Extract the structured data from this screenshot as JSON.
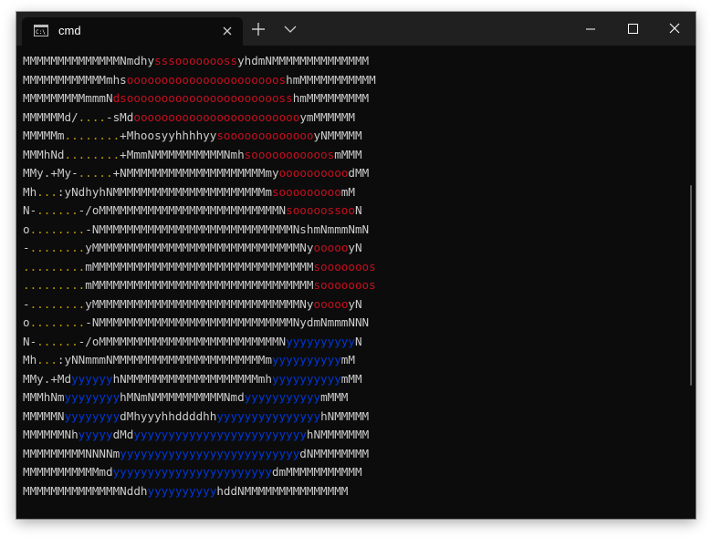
{
  "tab": {
    "title": "cmd",
    "icon": "cmd-icon"
  },
  "colors": {
    "white": "#cccccc",
    "red": "#c50f1f",
    "yellow": "#c19c00",
    "blue": "#0037da",
    "background": "#0c0c0c",
    "titlebar": "#202020"
  },
  "console_lines": [
    [
      [
        "w",
        "MMMMMMMMMMMMMMNmdhy"
      ],
      [
        "r",
        "sssoooooooss"
      ],
      [
        "w",
        "yhdmNMMMMMMMMMMMMMM"
      ]
    ],
    [
      [
        "w",
        "MMMMMMMMMMMMmhs"
      ],
      [
        "r",
        "oooooooooooooooooooooos"
      ],
      [
        "w",
        "hmMMMMMMMMMMM"
      ]
    ],
    [
      [
        "w",
        "MMMMMMMMMmmmN"
      ],
      [
        "r",
        "dsooooooooooooooooooooooss"
      ],
      [
        "w",
        "hmMMMMMMMMM"
      ]
    ],
    [
      [
        "w",
        "MMMMMMd/"
      ],
      [
        "y",
        "...."
      ],
      [
        "w",
        "-sMd"
      ],
      [
        "r",
        "oooooooooooooooooooooooo"
      ],
      [
        "w",
        "ymMMMMMM"
      ]
    ],
    [
      [
        "w",
        "MMMMMm"
      ],
      [
        "y",
        "........"
      ],
      [
        "w",
        "+Mhoosyyhhhhyy"
      ],
      [
        "r",
        "sooooooooooooo"
      ],
      [
        "w",
        "yNMMMMM"
      ]
    ],
    [
      [
        "w",
        "MMMhNd"
      ],
      [
        "y",
        "........"
      ],
      [
        "w",
        "+MmmNMMMMMMMMMMNmh"
      ],
      [
        "r",
        "sooooooooooos"
      ],
      [
        "w",
        "mMMM"
      ]
    ],
    [
      [
        "w",
        "MMy.+My-"
      ],
      [
        "y",
        "....."
      ],
      [
        "w",
        "+NMMMMMMMMMMMMMMMMMMMMmy"
      ],
      [
        "r",
        "oooooooooo"
      ],
      [
        "w",
        "dMM"
      ]
    ],
    [
      [
        "w",
        "Mh"
      ],
      [
        "y",
        "..."
      ],
      [
        "w",
        ":yNdhyhNMMMMMMMMMMMMMMMMMMMMMMm"
      ],
      [
        "r",
        "sooooooooo"
      ],
      [
        "w",
        "mM"
      ]
    ],
    [
      [
        "w",
        "N-"
      ],
      [
        "y",
        "......"
      ],
      [
        "w",
        "-/oMMMMMMMMMMMMMMMMMMMMMMMMMMN"
      ],
      [
        "r",
        "sooooossoo"
      ],
      [
        "w",
        "N"
      ]
    ],
    [
      [
        "w",
        "o"
      ],
      [
        "y",
        "........"
      ],
      [
        "w",
        "-NMMMMMMMMMMMMMMMMMMMMMMMMMMMMNshmNmmmNmN"
      ]
    ],
    [
      [
        "w",
        "-"
      ],
      [
        "y",
        "........"
      ],
      [
        "w",
        "yMMMMMMMMMMMMMMMMMMMMMMMMMMMMMMNy"
      ],
      [
        "r",
        "ooooo"
      ],
      [
        "w",
        "yN"
      ]
    ],
    [
      [
        "y",
        "........."
      ],
      [
        "w",
        "mMMMMMMMMMMMMMMMMMMMMMMMMMMMMMMMM"
      ],
      [
        "r",
        "sooooooos"
      ]
    ],
    [
      [
        "y",
        "........."
      ],
      [
        "w",
        "mMMMMMMMMMMMMMMMMMMMMMMMMMMMMMMMM"
      ],
      [
        "r",
        "sooooooos"
      ]
    ],
    [
      [
        "w",
        "-"
      ],
      [
        "y",
        "........"
      ],
      [
        "w",
        "yMMMMMMMMMMMMMMMMMMMMMMMMMMMMMMNy"
      ],
      [
        "r",
        "ooooo"
      ],
      [
        "w",
        "yN"
      ]
    ],
    [
      [
        "w",
        "o"
      ],
      [
        "y",
        "........"
      ],
      [
        "w",
        "-NMMMMMMMMMMMMMMMMMMMMMMMMMMMMNydmNmmmNNN"
      ]
    ],
    [
      [
        "w",
        "N-"
      ],
      [
        "y",
        "......"
      ],
      [
        "w",
        "-/oMMMMMMMMMMMMMMMMMMMMMMMMMMN"
      ],
      [
        "b",
        "yyyyyyyyyy"
      ],
      [
        "w",
        "N"
      ]
    ],
    [
      [
        "w",
        "Mh"
      ],
      [
        "y",
        "..."
      ],
      [
        "w",
        ":yNNmmmNMMMMMMMMMMMMMMMMMMMMMMm"
      ],
      [
        "b",
        "yyyyyyyyyy"
      ],
      [
        "w",
        "mM"
      ]
    ],
    [
      [
        "w",
        "MMy.+Md"
      ],
      [
        "b",
        "yyyyyy"
      ],
      [
        "w",
        "hNMMMMMMMMMMMMMMMMMMMmh"
      ],
      [
        "b",
        "yyyyyyyyyy"
      ],
      [
        "w",
        "mMM"
      ]
    ],
    [
      [
        "w",
        "MMMhNm"
      ],
      [
        "b",
        "yyyyyyyy"
      ],
      [
        "w",
        "hMNmNMMMMMMMMMMNmd"
      ],
      [
        "b",
        "yyyyyyyyyyy"
      ],
      [
        "w",
        "mMMM"
      ]
    ],
    [
      [
        "w",
        "MMMMMN"
      ],
      [
        "b",
        "yyyyyyyy"
      ],
      [
        "w",
        "dMhyyyhhddddhh"
      ],
      [
        "b",
        "yyyyyyyyyyyyyyy"
      ],
      [
        "w",
        "hNMMMMM"
      ]
    ],
    [
      [
        "w",
        "MMMMMMNh"
      ],
      [
        "b",
        "yyyyy"
      ],
      [
        "w",
        "dMd"
      ],
      [
        "b",
        "yyyyyyyyyyyyyyyyyyyyyyyyy"
      ],
      [
        "w",
        "hNMMMMMMM"
      ]
    ],
    [
      [
        "w",
        "MMMMMMMMMNNNNm"
      ],
      [
        "b",
        "yyyyyyyyyyyyyyyyyyyyyyyyyy"
      ],
      [
        "w",
        "dNMMMMMMMM"
      ]
    ],
    [
      [
        "w",
        "MMMMMMMMMMMmd"
      ],
      [
        "b",
        "yyyyyyyyyyyyyyyyyyyyyyy"
      ],
      [
        "w",
        "dmMMMMMMMMMMM"
      ]
    ],
    [
      [
        "w",
        "MMMMMMMMMMMMMMNddh"
      ],
      [
        "b",
        "yyyyyyyyyy"
      ],
      [
        "w",
        "hddNMMMMMMMMMMMMMMM"
      ]
    ]
  ]
}
